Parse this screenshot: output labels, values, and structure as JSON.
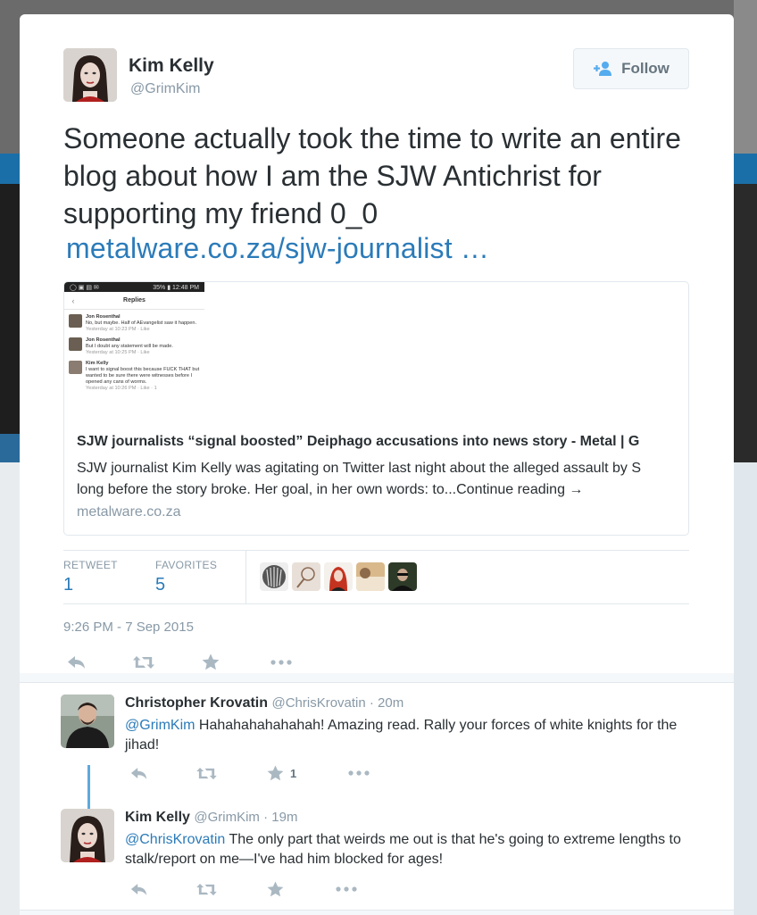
{
  "tweet": {
    "author_name": "Kim Kelly",
    "author_handle": "@GrimKim",
    "follow_label": "Follow",
    "text": "Someone actually took the time to write an entire blog about how I am the SJW Antichrist for supporting my friend 0_0",
    "link": "metalware.co.za/sjw-journalist  …",
    "card": {
      "thumb": {
        "status_time": "12:48 PM",
        "status_battery": "35%",
        "header": "Replies",
        "replies": [
          {
            "name": "Jon Rosenthal",
            "text": "No, but maybe. Half of AEvangelist saw it happen.",
            "meta": "Yesterday at 10:23 PM · Like"
          },
          {
            "name": "Jon Rosenthal",
            "text": "But I doubt any statement will be made.",
            "meta": "Yesterday at 10:25 PM · Like"
          },
          {
            "name": "Kim Kelly",
            "text": "I want to signal boost this because FUCK THAT but wanted to be sure there were witnesses before I opened any cans of worms.",
            "meta": "Yesterday at 10:26 PM · Like · 1"
          }
        ]
      },
      "title": "SJW journalists “signal boosted” Deiphago accusations into news story - Metal | G",
      "desc_line1": "SJW journalist Kim Kelly was agitating on Twitter last night about the alleged assault by S",
      "desc_line2": "long before the story broke. Her goal, in her own words: to...Continue reading →",
      "domain": "metalware.co.za"
    },
    "stats": {
      "retweet_label": "RETWEET",
      "retweet_count": "1",
      "favorites_label": "FAVORITES",
      "favorites_count": "5"
    },
    "timestamp": "9:26 PM - 7 Sep 2015"
  },
  "replies": [
    {
      "name": "Christopher Krovatin",
      "handle": "@ChrisKrovatin · 20m",
      "mention": "@GrimKim",
      "text": " Hahahahahahahah! Amazing read. Rally your forces of white knights for the jihad!",
      "favorite_count": "1"
    },
    {
      "name": "Kim Kelly",
      "handle": "@GrimKim · 19m",
      "mention": "@ChrisKrovatin",
      "text": " The only part that weirds me out is that he's going to extreme lengths to stalk/report on me—I've had him blocked for ages!",
      "favorite_count": ""
    }
  ],
  "icons": [
    "reply-icon",
    "retweet-icon",
    "favorite-icon",
    "more-icon",
    "follow-icon"
  ],
  "colors": {
    "link": "#2b7bb9",
    "muted": "#8899a6",
    "text": "#292f33",
    "thread": "#5ea9dd"
  }
}
